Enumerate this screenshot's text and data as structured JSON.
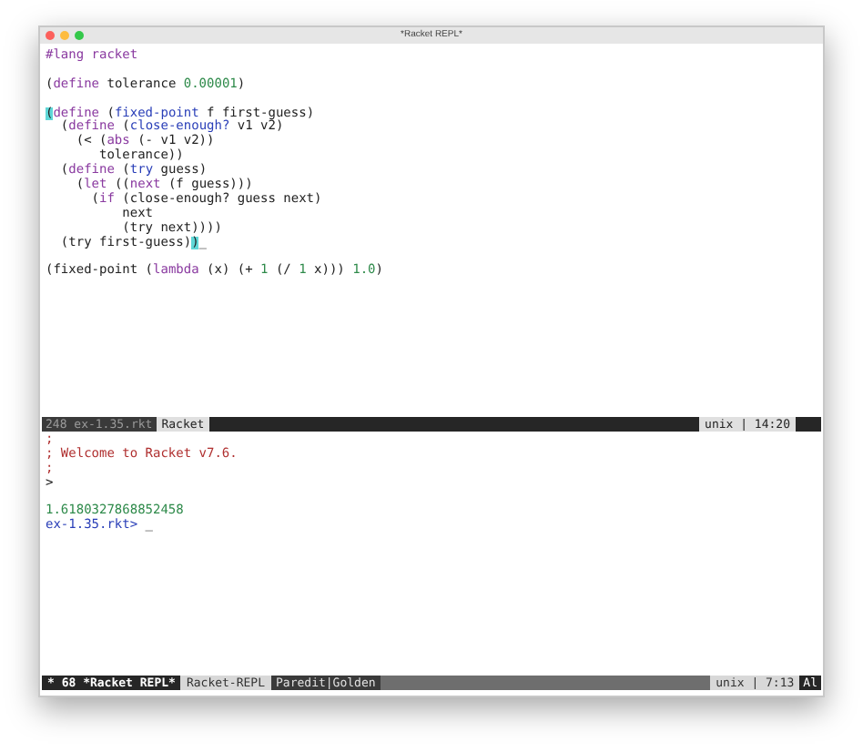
{
  "window": {
    "title": "*Racket REPL*"
  },
  "editor": {
    "lines": [
      {
        "segments": [
          {
            "text": "#lang racket",
            "kind": "keyword"
          }
        ]
      },
      {
        "gap_before": true,
        "segments": [
          {
            "text": "(",
            "kind": "plain"
          },
          {
            "text": "define",
            "kind": "keyword"
          },
          {
            "text": " tolerance ",
            "kind": "plain"
          },
          {
            "text": "0.00001",
            "kind": "number"
          },
          {
            "text": ")",
            "kind": "plain"
          }
        ]
      },
      {
        "gap_before": true,
        "segments": [
          {
            "text": "(",
            "kind": "match"
          },
          {
            "text": "define",
            "kind": "keyword"
          },
          {
            "text": " (",
            "kind": "plain"
          },
          {
            "text": "fixed-point",
            "kind": "builtin"
          },
          {
            "text": " f first-guess)",
            "kind": "plain"
          }
        ]
      },
      {
        "segments": [
          {
            "text": "  (",
            "kind": "plain"
          },
          {
            "text": "define",
            "kind": "keyword"
          },
          {
            "text": " (",
            "kind": "plain"
          },
          {
            "text": "close-enough?",
            "kind": "builtin"
          },
          {
            "text": " v1 v2)",
            "kind": "plain"
          }
        ]
      },
      {
        "segments": [
          {
            "text": "    (< (",
            "kind": "plain"
          },
          {
            "text": "abs",
            "kind": "keyword"
          },
          {
            "text": " (- v1 v2))",
            "kind": "plain"
          }
        ]
      },
      {
        "segments": [
          {
            "text": "       tolerance))",
            "kind": "plain"
          }
        ]
      },
      {
        "segments": [
          {
            "text": "  (",
            "kind": "plain"
          },
          {
            "text": "define",
            "kind": "keyword"
          },
          {
            "text": " (",
            "kind": "plain"
          },
          {
            "text": "try",
            "kind": "builtin"
          },
          {
            "text": " guess)",
            "kind": "plain"
          }
        ]
      },
      {
        "segments": [
          {
            "text": "    (",
            "kind": "plain"
          },
          {
            "text": "let",
            "kind": "keyword"
          },
          {
            "text": " ((",
            "kind": "plain"
          },
          {
            "text": "next",
            "kind": "keyword"
          },
          {
            "text": " (f guess)))",
            "kind": "plain"
          }
        ]
      },
      {
        "segments": [
          {
            "text": "      (",
            "kind": "plain"
          },
          {
            "text": "if",
            "kind": "keyword"
          },
          {
            "text": " (close-enough? guess next)",
            "kind": "plain"
          }
        ]
      },
      {
        "segments": [
          {
            "text": "          next",
            "kind": "plain"
          }
        ]
      },
      {
        "segments": [
          {
            "text": "          (try next))))",
            "kind": "plain"
          }
        ]
      },
      {
        "segments": [
          {
            "text": "  (try first-guess)",
            "kind": "plain"
          },
          {
            "text": ")",
            "kind": "match"
          },
          {
            "text": "_",
            "kind": "cursor"
          }
        ]
      },
      {
        "gap_before": true,
        "segments": [
          {
            "text": "(fixed-point (",
            "kind": "plain"
          },
          {
            "text": "lambda",
            "kind": "keyword"
          },
          {
            "text": " (x) (+ ",
            "kind": "plain"
          },
          {
            "text": "1",
            "kind": "number"
          },
          {
            "text": " (/ ",
            "kind": "plain"
          },
          {
            "text": "1",
            "kind": "number"
          },
          {
            "text": " x))) ",
            "kind": "plain"
          },
          {
            "text": "1.0",
            "kind": "number"
          },
          {
            "text": ")",
            "kind": "plain"
          }
        ]
      }
    ]
  },
  "editor_mode_line": {
    "buffer": "248 ex-1.35.rkt",
    "mode": "Racket",
    "encoding": "unix | 14:20"
  },
  "repl": {
    "lines": [
      {
        "segments": [
          {
            "text": ";",
            "kind": "comment"
          }
        ]
      },
      {
        "segments": [
          {
            "text": "; Welcome to Racket v7.6.",
            "kind": "comment"
          }
        ]
      },
      {
        "segments": [
          {
            "text": ";",
            "kind": "comment"
          }
        ]
      },
      {
        "segments": [
          {
            "text": ">",
            "kind": "plain"
          }
        ]
      },
      {
        "gap_before": true,
        "segments": [
          {
            "text": "1.6180327868852458",
            "kind": "number"
          }
        ]
      },
      {
        "segments": [
          {
            "text": "ex-1.35.rkt> ",
            "kind": "prompt"
          },
          {
            "text": "_",
            "kind": "cursor"
          }
        ]
      }
    ]
  },
  "repl_mode_line": {
    "buffer": "* 68 *Racket REPL*",
    "mode": "Racket-REPL",
    "minor_modes": "Paredit|Golden",
    "encoding": "unix | 7:13",
    "position": "Al"
  }
}
